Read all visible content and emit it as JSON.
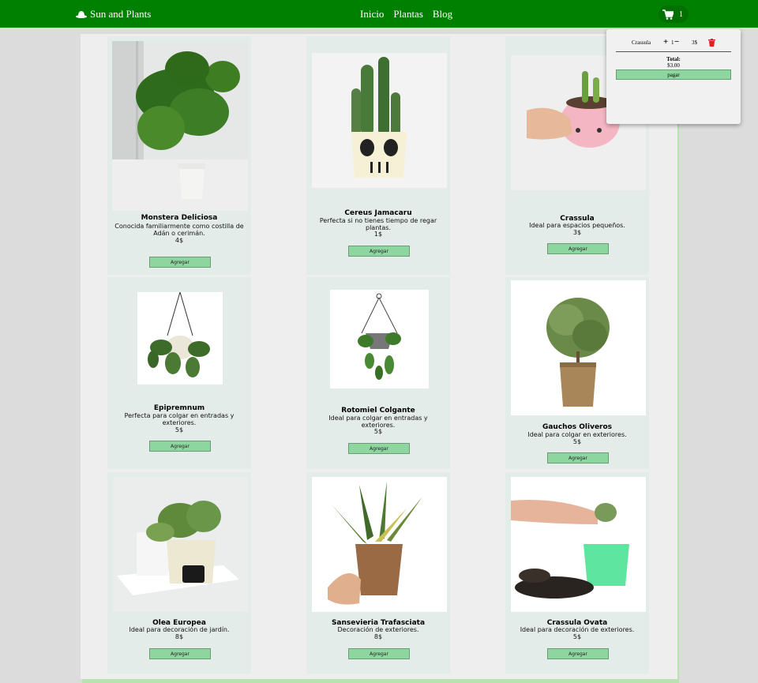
{
  "nav": {
    "brand": "Sun and Plants",
    "links": [
      "Inicio",
      "Plantas",
      "Blog"
    ],
    "cart_count": "1"
  },
  "products": [
    {
      "name": "Monstera Deliciosa",
      "desc": "Conocida familiarmente como costilla de Adán o cerimán.",
      "price": "4$",
      "button": "Agregar"
    },
    {
      "name": "Cereus Jamacaru",
      "desc": "Perfecta si no tienes tiempo de regar plantas.",
      "price": "1$",
      "button": "Agregar"
    },
    {
      "name": "Crassula",
      "desc": "Ideal para espacios pequeños.",
      "price": "3$",
      "button": "Agregar"
    },
    {
      "name": "Epipremnum",
      "desc": "Perfecta para colgar en entradas y exteriores.",
      "price": "5$",
      "button": "Agregar"
    },
    {
      "name": "Rotomiel Colgante",
      "desc": "Ideal para colgar en entradas y exteriores.",
      "price": "5$",
      "button": "Agregar"
    },
    {
      "name": "Gauchos Oliveros",
      "desc": "Ideal para colgar en exteriores.",
      "price": "5$",
      "button": "Agregar"
    },
    {
      "name": "Olea Europea",
      "desc": "Ideal para decoración de jardín.",
      "price": "8$",
      "button": "Agregar"
    },
    {
      "name": "Sansevieria Trafasciata",
      "desc": "Decoración de exteriores.",
      "price": "8$",
      "button": "Agregar"
    },
    {
      "name": "Crassula Ovata",
      "desc": "Ideal para decoración de exteriores.",
      "price": "5$",
      "button": "Agregar"
    }
  ],
  "cart": {
    "items": [
      {
        "name": "Crassula",
        "plus": "+",
        "qty": "1",
        "minus": "−",
        "price": "3$"
      }
    ],
    "total_label": "Total:",
    "total_value": "$3.00",
    "pay_button": "pagar"
  },
  "colors": {
    "nav": "#008000",
    "button": "#8ed6a0",
    "card": "#e4ece9",
    "trash": "#e02020"
  },
  "icons": {
    "brand": "hat-icon",
    "cart": "cart-icon",
    "remove": "trash-icon"
  }
}
